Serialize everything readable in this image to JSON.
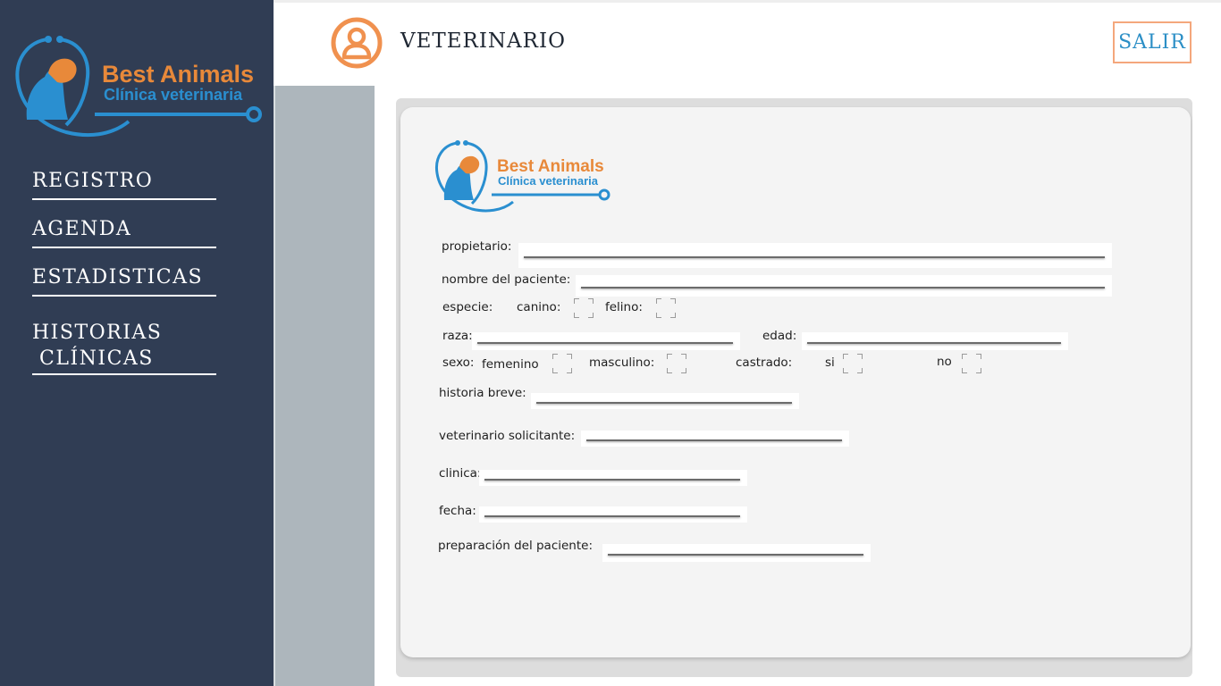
{
  "brand": {
    "name": "Best Animals",
    "tagline": "Clínica veterinaria",
    "orange": "#e8893a",
    "blue": "#2a8fd0"
  },
  "sidebar": {
    "items": [
      {
        "label": "REGISTRO"
      },
      {
        "label": "AGENDA"
      },
      {
        "label": "ESTADISTICAS"
      },
      {
        "label_line1": "HISTORIAS",
        "label_line2": "CLÍNICAS"
      }
    ]
  },
  "header": {
    "title": "VETERINARIO",
    "user_icon": "user-circle-icon",
    "logout_label": "SALIR"
  },
  "form": {
    "owner_label": "propietario:",
    "owner_value": "",
    "patient_name_label": "nombre del paciente:",
    "patient_name_value": "",
    "species_label": "especie:",
    "canine_label": "canino:",
    "feline_label": "felino:",
    "breed_label": "raza:",
    "breed_value": "",
    "age_label": "edad:",
    "age_value": "",
    "sex_label": "sexo:",
    "female_label": "femenino",
    "male_label": "masculino:",
    "neutered_label": "castrado:",
    "yes_label": "si",
    "no_label": "no",
    "history_label": "historia breve:",
    "history_value": "",
    "vet_label": "veterinario solicitante:",
    "vet_value": "",
    "clinic_label": "clinica:",
    "clinic_value": "",
    "date_label": "fecha:",
    "date_value": "",
    "prep_label": "preparación del paciente:",
    "prep_value": ""
  }
}
